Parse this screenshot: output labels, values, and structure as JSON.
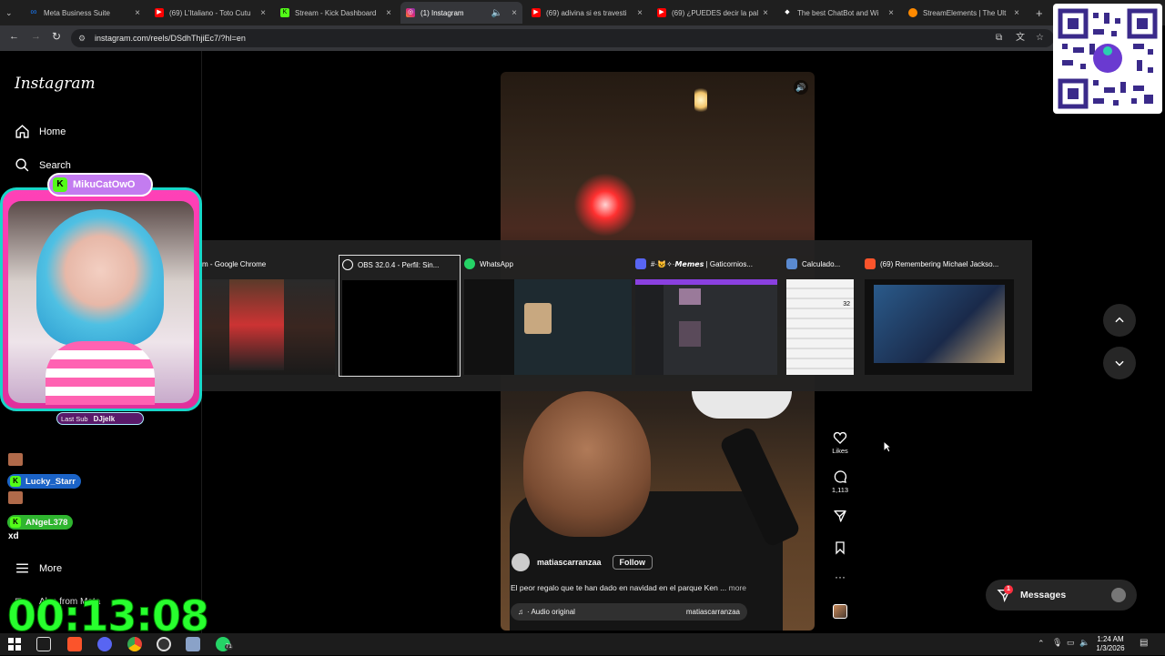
{
  "browser": {
    "tabs": [
      {
        "title": "Meta Business Suite",
        "icon": "meta-icon",
        "color": "#1877f2"
      },
      {
        "title": "(69) L'Italiano - Toto Cutu",
        "icon": "youtube-icon",
        "color": "#ff0000"
      },
      {
        "title": "Stream - Kick Dashboard",
        "icon": "kick-icon",
        "color": "#53fc18"
      },
      {
        "title": "(1) Instagram",
        "icon": "instagram-icon",
        "color": "#e1306c"
      },
      {
        "title": "(69) adivina si es travesti",
        "icon": "youtube-icon",
        "color": "#ff0000"
      },
      {
        "title": "(69) ¿PUEDES decir la pal",
        "icon": "youtube-icon",
        "color": "#ff0000"
      },
      {
        "title": "The best ChatBot and Wi",
        "icon": "bot-icon",
        "color": "#ffffff"
      },
      {
        "title": "StreamElements | The Ult",
        "icon": "streamelements-icon",
        "color": "#ff8a00"
      }
    ],
    "url": "instagram.com/reels/DSdhThjiEc7/?hl=en"
  },
  "instagram": {
    "logo": "Instagram",
    "nav": {
      "home": "Home",
      "search": "Search",
      "more": "More",
      "also_from_meta": "Also from Meta"
    },
    "reel": {
      "author": "matiascarranzaa",
      "follow": "Follow",
      "caption": "El peor regalo que te han dado en navidad en el parque Ken ...",
      "more": "more",
      "audio": "· Audio original",
      "audio_author": "matiascarranzaa",
      "likes_label": "Likes",
      "comments_count": "1,113"
    },
    "messages": {
      "label": "Messages",
      "badge": "1"
    }
  },
  "switcher": {
    "windows": [
      {
        "title": "m - Google Chrome",
        "icon": "chrome-icon"
      },
      {
        "title": "OBS 32.0.4 - Perfil: Sin...",
        "icon": "obs-icon"
      },
      {
        "title": "WhatsApp",
        "icon": "whatsapp-icon"
      },
      {
        "title": "#·😺✧·𝙈𝙚𝙢𝙚𝙨 | Gaticornios...",
        "icon": "discord-icon"
      },
      {
        "title": "Calculado...",
        "icon": "calculator-icon"
      },
      {
        "title": "(69) Remembering Michael Jackso...",
        "icon": "brave-icon"
      }
    ]
  },
  "stream_overlay": {
    "channel_tag": "MikuCatOwO",
    "last_sub_label": "Last Sub",
    "last_sub_name": "DJjelk",
    "chat": [
      {
        "name": "Lucky_Starr"
      },
      {
        "name": "ANgeL378",
        "message": "xd"
      }
    ],
    "timer": "00:13:08"
  },
  "taskbar": {
    "time": "1:24 AM",
    "date": "1/3/2026",
    "whatsapp_badge": "71"
  },
  "colors": {
    "timer_green": "#28ff2e",
    "overlay_pink": "#ff41b7",
    "overlay_teal": "#18d6c8",
    "kick_green": "#53fc18"
  }
}
